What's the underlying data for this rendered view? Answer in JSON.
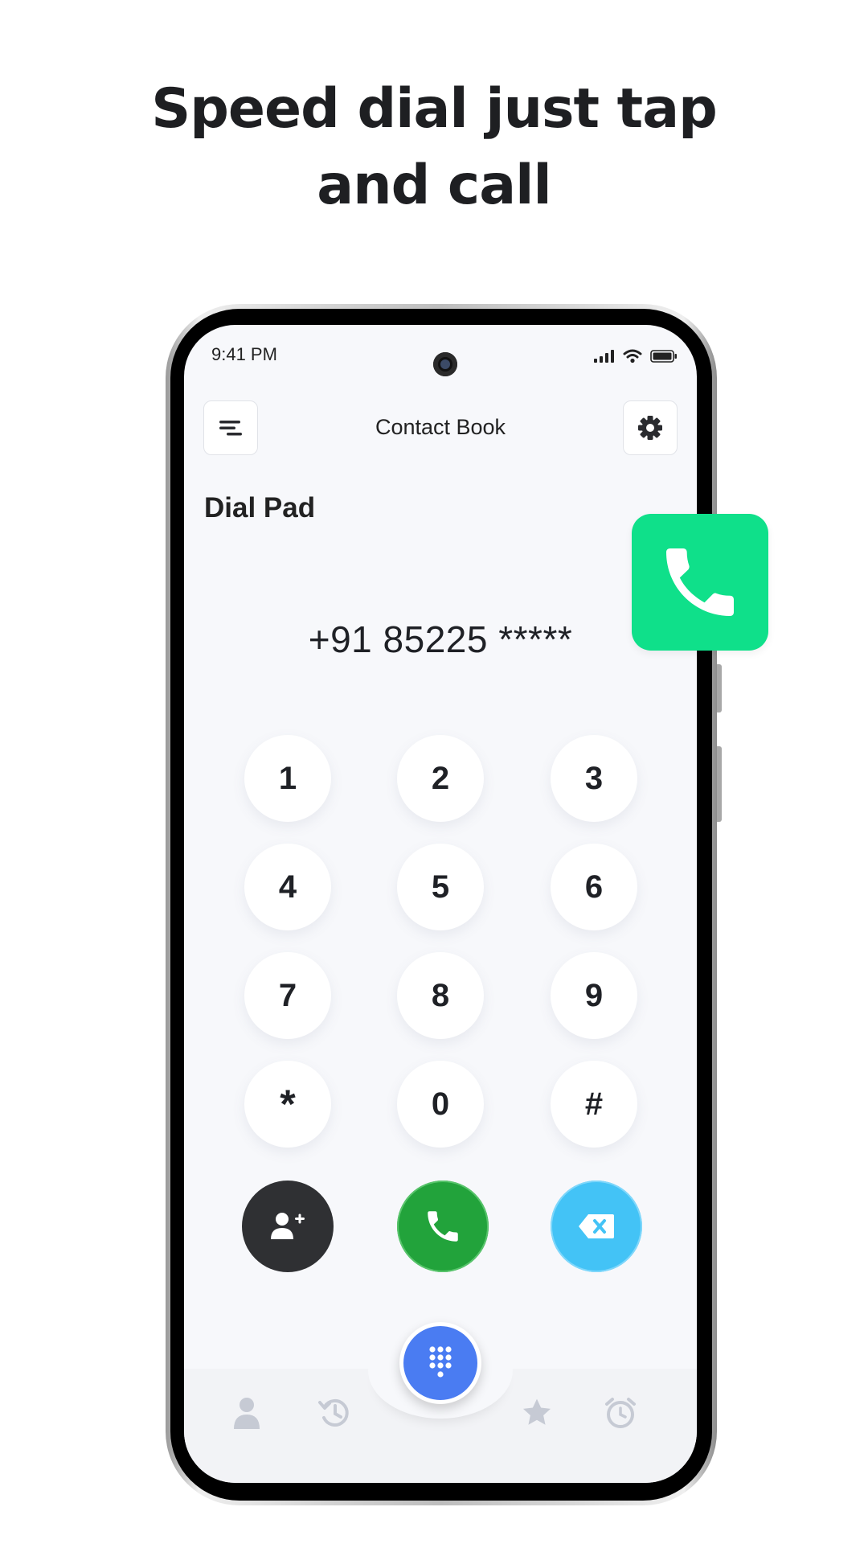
{
  "headline": {
    "line1": "Speed dial just tap",
    "line2": "and call"
  },
  "status_bar": {
    "time": "9:41 PM"
  },
  "header": {
    "title": "Contact Book",
    "menu_icon": "menu-icon",
    "settings_icon": "gear-icon"
  },
  "page": {
    "title": "Dial Pad"
  },
  "dialer": {
    "number": "+91 85225 *****",
    "keys": [
      "1",
      "2",
      "3",
      "4",
      "5",
      "6",
      "7",
      "8",
      "9",
      "*",
      "0",
      "#"
    ]
  },
  "actions": {
    "add_contact_icon": "add-contact-icon",
    "call_icon": "phone-icon",
    "backspace_icon": "backspace-icon"
  },
  "bottom_nav": {
    "items": [
      "contacts-icon",
      "history-icon",
      "dialpad-icon",
      "star-icon",
      "alarm-icon"
    ],
    "active": "dialpad-icon"
  },
  "colors": {
    "call_green": "#22a33b",
    "delete_blue": "#43c3f6",
    "add_dark": "#2f3033",
    "fab_blue": "#4a7cf2",
    "promo_tile_green": "#0fe08a"
  }
}
